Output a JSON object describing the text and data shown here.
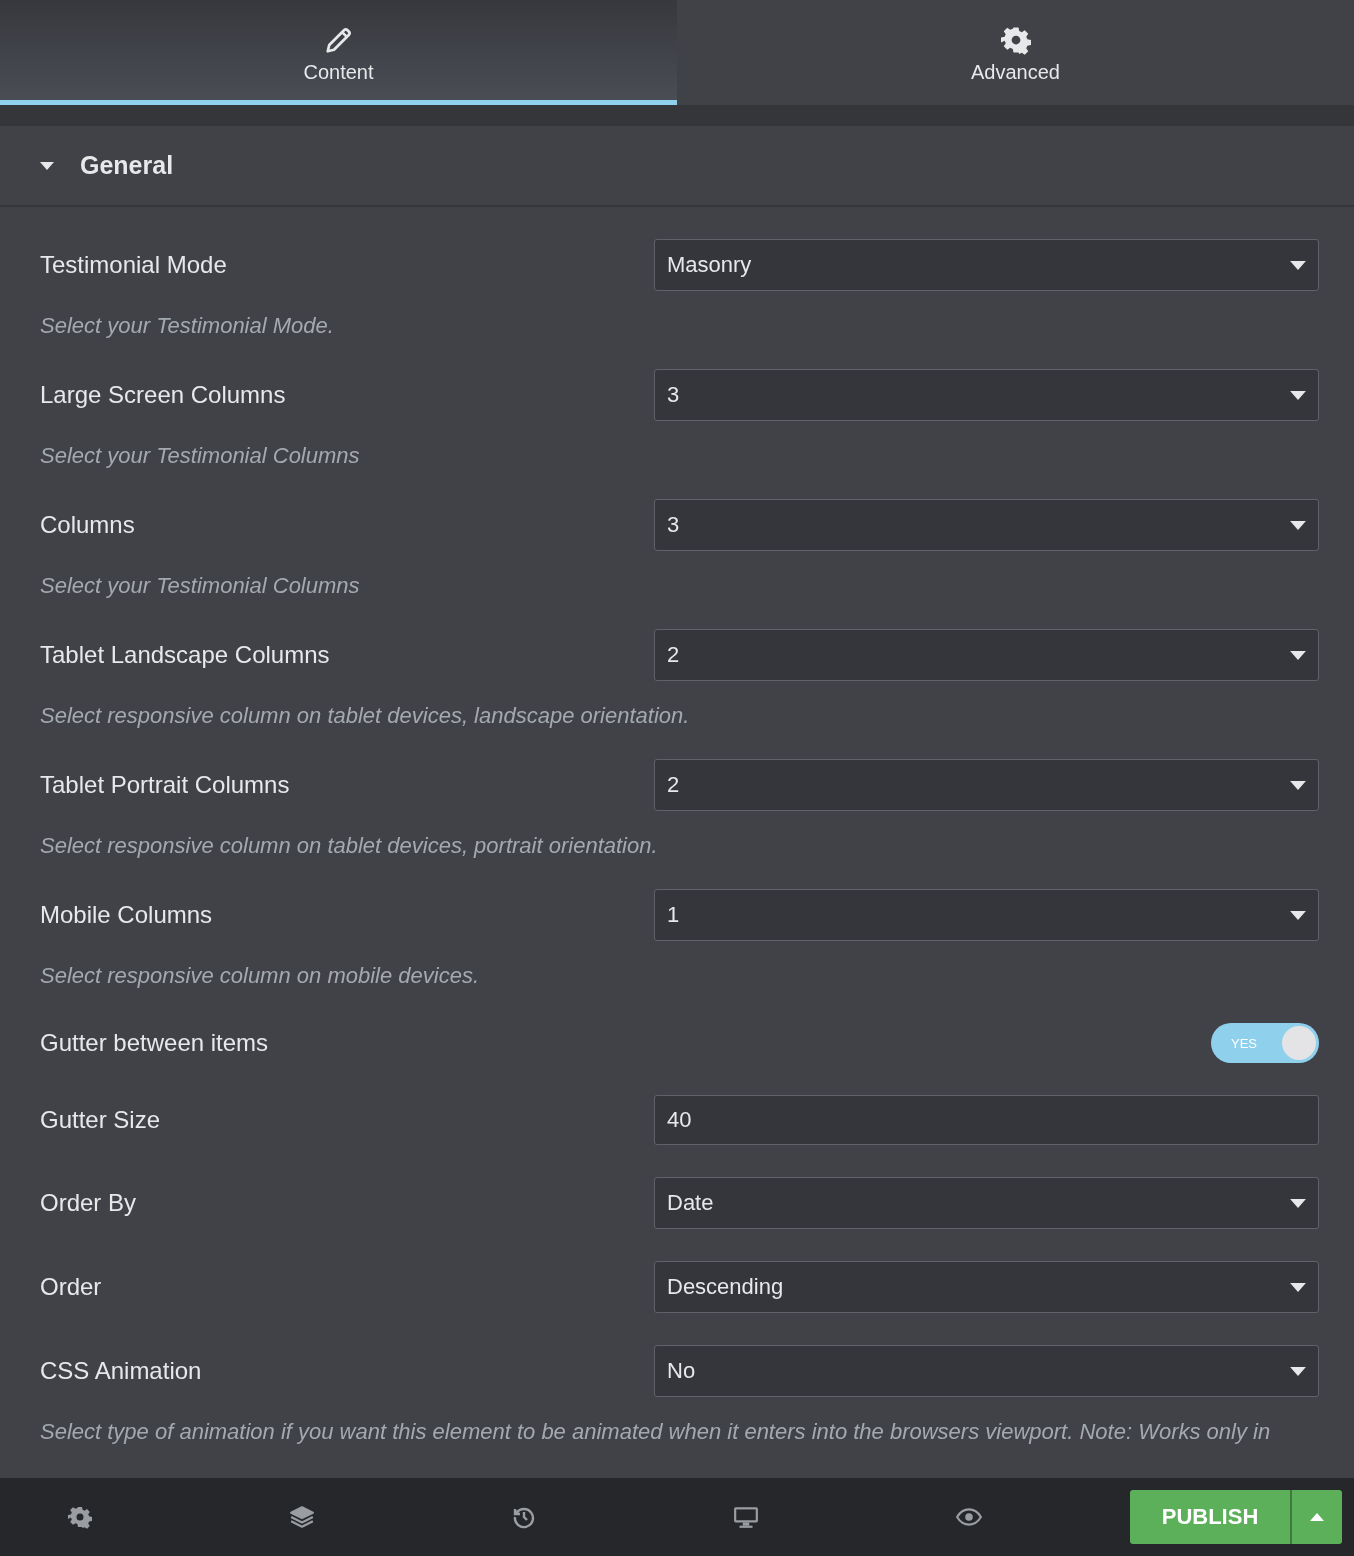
{
  "tabs": [
    {
      "label": "Content",
      "selected": true
    },
    {
      "label": "Advanced",
      "selected": false
    }
  ],
  "section": {
    "title": "General",
    "expanded": true
  },
  "fields": [
    {
      "kind": "select",
      "label": "Testimonial Mode",
      "value": "Masonry",
      "description": "Select your Testimonial Mode."
    },
    {
      "kind": "select",
      "label": "Large Screen Columns",
      "value": "3",
      "description": "Select your Testimonial Columns"
    },
    {
      "kind": "select",
      "label": "Columns",
      "value": "3",
      "description": "Select your Testimonial Columns"
    },
    {
      "kind": "select",
      "label": "Tablet Landscape Columns",
      "value": "2",
      "description": "Select responsive column on tablet devices, landscape orientation."
    },
    {
      "kind": "select",
      "label": "Tablet Portrait Columns",
      "value": "2",
      "description": "Select responsive column on tablet devices, portrait orientation."
    },
    {
      "kind": "select",
      "label": "Mobile Columns",
      "value": "1",
      "description": "Select responsive column on mobile devices."
    },
    {
      "kind": "toggle",
      "label": "Gutter between items",
      "on": true,
      "on_label": "YES"
    },
    {
      "kind": "input",
      "label": "Gutter Size",
      "value": "40"
    },
    {
      "kind": "select",
      "label": "Order By",
      "value": "Date"
    },
    {
      "kind": "select",
      "label": "Order",
      "value": "Descending"
    },
    {
      "kind": "select",
      "label": "CSS Animation",
      "value": "No",
      "description": "Select type of animation if you want this element to be animated when it enters into the browsers viewport. Note: Works only in"
    }
  ],
  "footer": {
    "publish": "PUBLISH"
  }
}
